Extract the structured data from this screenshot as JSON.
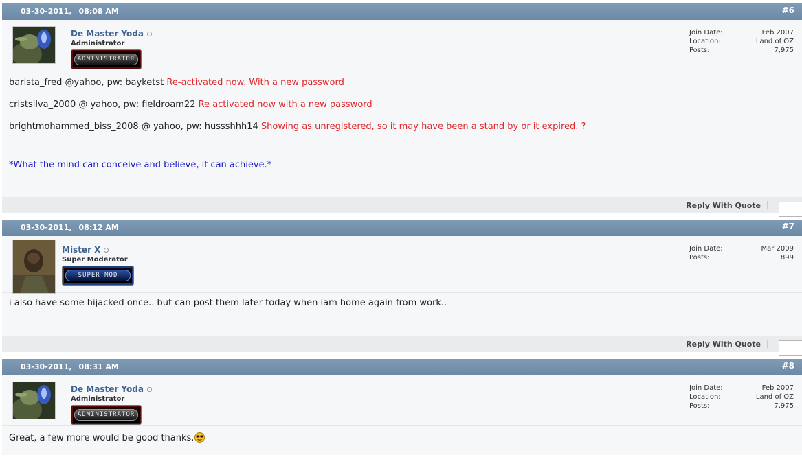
{
  "posts": [
    {
      "date": "03-30-2011,",
      "time": "08:08 AM",
      "number": "#6",
      "user": {
        "name": "De Master Yoda",
        "title": "Administrator",
        "rank": "ADMINISTRATOR",
        "avatar_icon": "yoda-avatar"
      },
      "stats": [
        {
          "label": "Join Date:",
          "value": "Feb 2007"
        },
        {
          "label": "Location:",
          "value": "Land of OZ"
        },
        {
          "label": "Posts:",
          "value": "7,975"
        }
      ],
      "lines": [
        {
          "plain": "barista_fred @yahoo, pw: bayketst ",
          "note": "Re-activated now. With a new password"
        },
        {
          "plain": "cristsilva_2000 @ yahoo, pw: fieldroam22 ",
          "note": "Re activated now with a new password"
        },
        {
          "plain": "brightmohammed_biss_2008 @ yahoo, pw: hussshhh14 ",
          "note": "Showing as unregistered, so it may have been a stand by or it expired. ?"
        }
      ],
      "signature": "*What the mind can conceive and believe, it can achieve.*",
      "reply_label": "Reply With Quote"
    },
    {
      "date": "03-30-2011,",
      "time": "08:12 AM",
      "number": "#7",
      "user": {
        "name": "Mister X",
        "title": "Super Moderator",
        "rank": "SUPER MOD",
        "avatar_icon": "soldier-avatar"
      },
      "stats": [
        {
          "label": "Join Date:",
          "value": "Mar 2009"
        },
        {
          "label": "Posts:",
          "value": "899"
        }
      ],
      "text": "i also have some hijacked once.. but can post them later today when iam home again from work..",
      "reply_label": "Reply With Quote"
    },
    {
      "date": "03-30-2011,",
      "time": "08:31 AM",
      "number": "#8",
      "user": {
        "name": "De Master Yoda",
        "title": "Administrator",
        "rank": "ADMINISTRATOR",
        "avatar_icon": "yoda-avatar"
      },
      "stats": [
        {
          "label": "Join Date:",
          "value": "Feb 2007"
        },
        {
          "label": "Location:",
          "value": "Land of OZ"
        },
        {
          "label": "Posts:",
          "value": "7,975"
        }
      ],
      "text": "Great, a few more would be good thanks.",
      "emoji_icon": "cool-smiley-icon"
    }
  ],
  "colors": {
    "header": "#7492ad",
    "username": "#3d6291",
    "note_red": "#e0262a",
    "signature_blue": "#1a1acc"
  }
}
